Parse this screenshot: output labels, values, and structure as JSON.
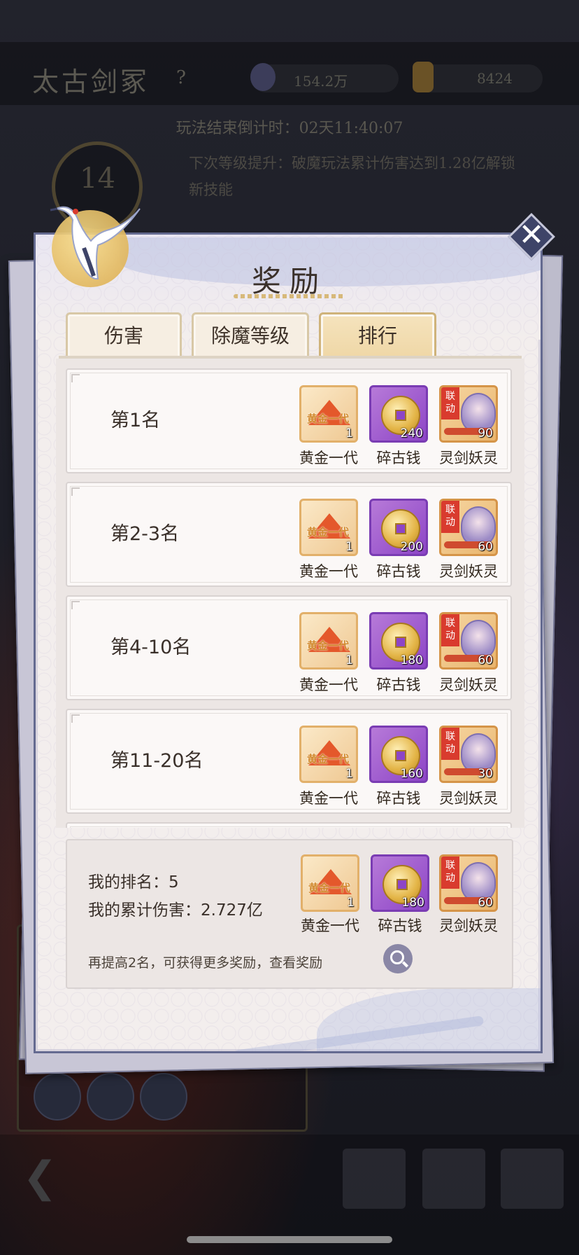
{
  "background": {
    "title": "太古剑冢",
    "help": "?",
    "resource1_value": "154.2万",
    "resource2_value": "8424",
    "countdown": "玩法结束倒计时：02天11:40:07",
    "level": "14",
    "desc": "下次等级提升：破魔玩法累计伤害达到1.28亿解锁新技能"
  },
  "modal": {
    "title": "奖励",
    "tabs": [
      {
        "label": "伤害",
        "active": false
      },
      {
        "label": "除魔等级",
        "active": false
      },
      {
        "label": "排行",
        "active": true
      }
    ],
    "ranks": [
      {
        "label": "第1名",
        "items": [
          {
            "name": "黄金一代",
            "qty": "1",
            "type": "gold"
          },
          {
            "name": "碎古钱",
            "qty": "240",
            "type": "coin"
          },
          {
            "name": "灵剑妖灵",
            "qty": "90",
            "type": "linkage"
          }
        ]
      },
      {
        "label": "第2-3名",
        "items": [
          {
            "name": "黄金一代",
            "qty": "1",
            "type": "gold"
          },
          {
            "name": "碎古钱",
            "qty": "200",
            "type": "coin"
          },
          {
            "name": "灵剑妖灵",
            "qty": "60",
            "type": "linkage"
          }
        ]
      },
      {
        "label": "第4-10名",
        "items": [
          {
            "name": "黄金一代",
            "qty": "1",
            "type": "gold"
          },
          {
            "name": "碎古钱",
            "qty": "180",
            "type": "coin"
          },
          {
            "name": "灵剑妖灵",
            "qty": "60",
            "type": "linkage"
          }
        ]
      },
      {
        "label": "第11-20名",
        "items": [
          {
            "name": "黄金一代",
            "qty": "1",
            "type": "gold"
          },
          {
            "name": "碎古钱",
            "qty": "160",
            "type": "coin"
          },
          {
            "name": "灵剑妖灵",
            "qty": "30",
            "type": "linkage"
          }
        ]
      }
    ],
    "linkage_tag": "联动",
    "gold_art_text": "黄金一代",
    "summary": {
      "my_rank": "我的排名：5",
      "my_damage": "我的累计伤害：2.727亿",
      "items": [
        {
          "name": "黄金一代",
          "qty": "1",
          "type": "gold"
        },
        {
          "name": "碎古钱",
          "qty": "180",
          "type": "coin"
        },
        {
          "name": "灵剑妖灵",
          "qty": "60",
          "type": "linkage"
        }
      ],
      "hint": "再提高2名，可获得更多奖励，查看奖励"
    },
    "close_icon": "close-icon",
    "search_icon": "search-icon"
  }
}
